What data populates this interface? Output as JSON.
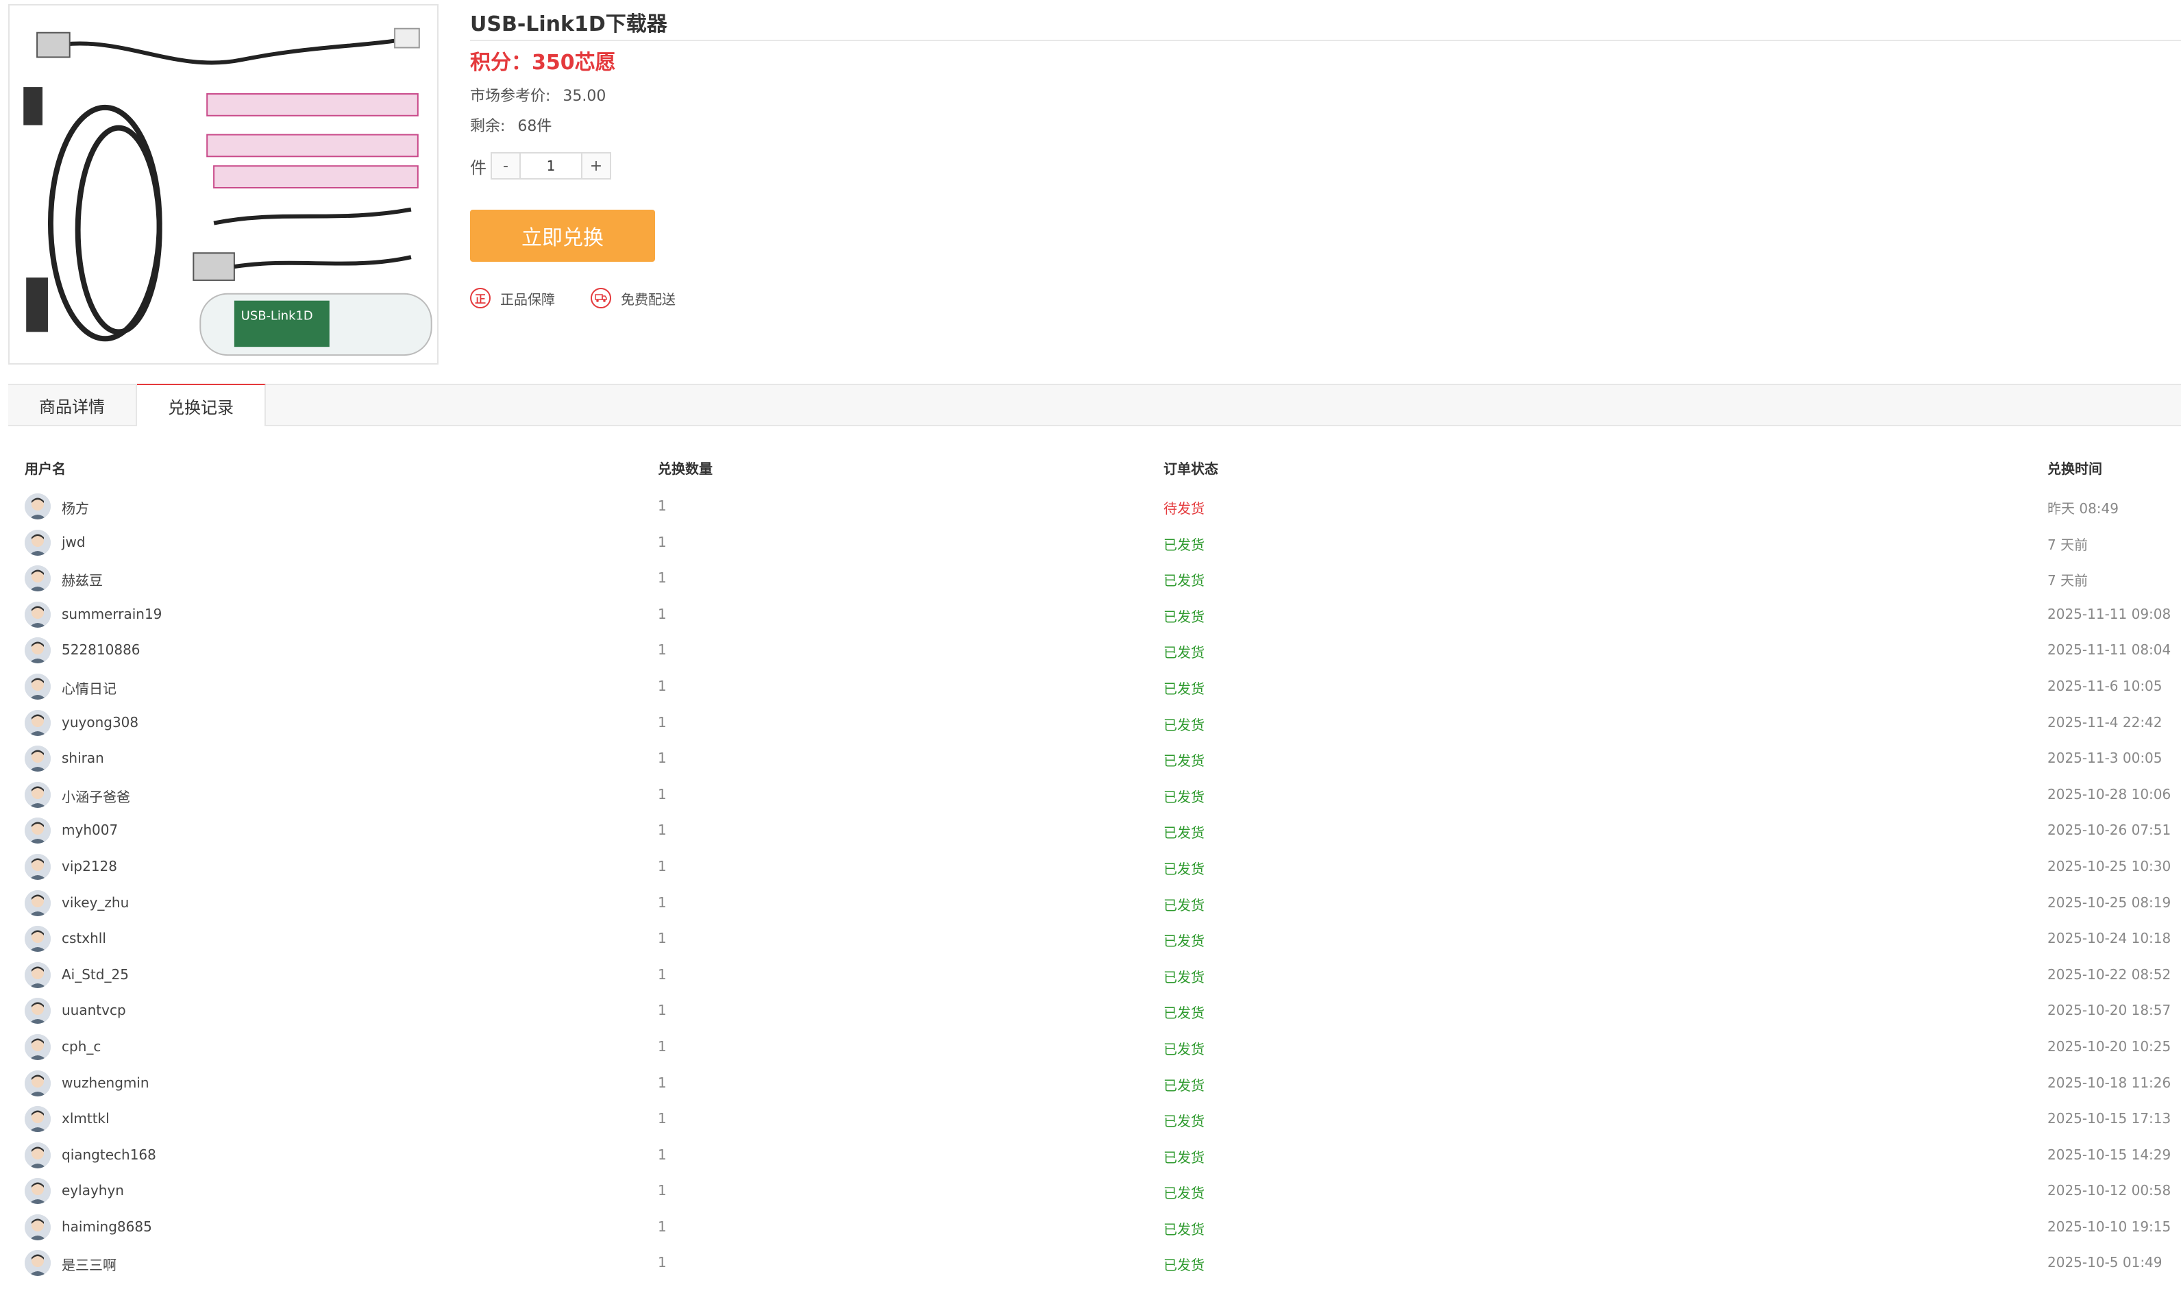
{
  "product": {
    "title": "USB-Link1D下载器",
    "price": "积分：350芯愿",
    "market_label": "市场参考价:",
    "market_value": "35.00",
    "stock_label": "剩余:",
    "stock_value": "68件",
    "qty_label": "件",
    "qty_minus": "-",
    "qty_value": "1",
    "qty_plus": "+",
    "redeem_label": "立即兑换",
    "guarantee_1": "正品保障",
    "guarantee_1_icon": "正",
    "guarantee_2": "免费配送",
    "image_text": "USB-Link1D"
  },
  "tabs": {
    "detail": "商品详情",
    "records": "兑换记录"
  },
  "records": {
    "headers": {
      "user": "用户名",
      "qty": "兑换数量",
      "status": "订单状态",
      "time": "兑换时间"
    },
    "rows": [
      {
        "user": "杨方",
        "qty": "1",
        "status": "待发货",
        "time": "昨天 08:49"
      },
      {
        "user": "jwd",
        "qty": "1",
        "status": "已发货",
        "time": "7 天前"
      },
      {
        "user": "赫兹豆",
        "qty": "1",
        "status": "已发货",
        "time": "7 天前"
      },
      {
        "user": "summerrain19",
        "qty": "1",
        "status": "已发货",
        "time": "2025-11-11 09:08"
      },
      {
        "user": "522810886",
        "qty": "1",
        "status": "已发货",
        "time": "2025-11-11 08:04"
      },
      {
        "user": "心情日记",
        "qty": "1",
        "status": "已发货",
        "time": "2025-11-6 10:05"
      },
      {
        "user": "yuyong308",
        "qty": "1",
        "status": "已发货",
        "time": "2025-11-4 22:42"
      },
      {
        "user": "shiran",
        "qty": "1",
        "status": "已发货",
        "time": "2025-11-3 00:05"
      },
      {
        "user": "小涵子爸爸",
        "qty": "1",
        "status": "已发货",
        "time": "2025-10-28 10:06"
      },
      {
        "user": "myh007",
        "qty": "1",
        "status": "已发货",
        "time": "2025-10-26 07:51"
      },
      {
        "user": "vip2128",
        "qty": "1",
        "status": "已发货",
        "time": "2025-10-25 10:30"
      },
      {
        "user": "vikey_zhu",
        "qty": "1",
        "status": "已发货",
        "time": "2025-10-25 08:19"
      },
      {
        "user": "cstxhll",
        "qty": "1",
        "status": "已发货",
        "time": "2025-10-24 10:18"
      },
      {
        "user": "Ai_Std_25",
        "qty": "1",
        "status": "已发货",
        "time": "2025-10-22 08:52"
      },
      {
        "user": "uuantvcp",
        "qty": "1",
        "status": "已发货",
        "time": "2025-10-20 18:57"
      },
      {
        "user": "cph_c",
        "qty": "1",
        "status": "已发货",
        "time": "2025-10-20 10:25"
      },
      {
        "user": "wuzhengmin",
        "qty": "1",
        "status": "已发货",
        "time": "2025-10-18 11:26"
      },
      {
        "user": "xlmttkl",
        "qty": "1",
        "status": "已发货",
        "time": "2025-10-15 17:13"
      },
      {
        "user": "qiangtech168",
        "qty": "1",
        "status": "已发货",
        "time": "2025-10-15 14:29"
      },
      {
        "user": "eylayhyn",
        "qty": "1",
        "status": "已发货",
        "time": "2025-10-12 00:58"
      },
      {
        "user": "haiming8685",
        "qty": "1",
        "status": "已发货",
        "time": "2025-10-10 19:15"
      },
      {
        "user": "是三三啊",
        "qty": "1",
        "status": "已发货",
        "time": "2025-10-5 01:49"
      }
    ]
  },
  "colors": {
    "accent_red": "#e4393c",
    "button_orange": "#f9a73e",
    "shipped_green": "#2e9a2e"
  },
  "icons": {
    "guarantee": "genuine-badge-icon",
    "delivery": "truck-icon",
    "avatar": "default-avatar-icon"
  }
}
